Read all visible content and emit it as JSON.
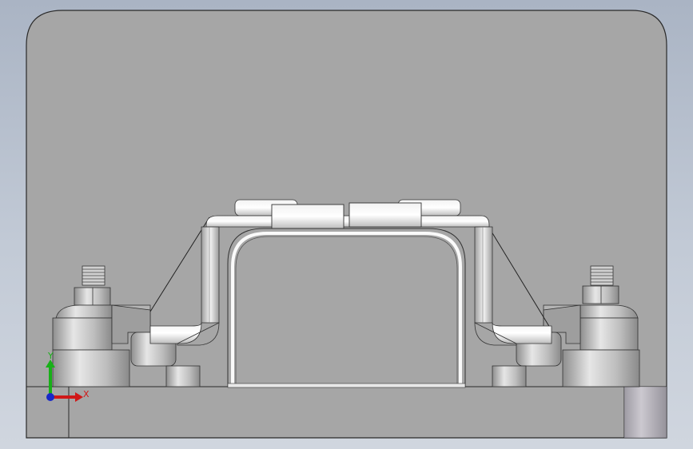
{
  "viewport": {
    "triad": {
      "x_label": "X",
      "y_label": "Y"
    }
  },
  "colors": {
    "background_top": "#aab4c4",
    "background_bottom": "#d0d6df",
    "part_face": "#a6a6a6",
    "part_edge": "#2a2a2a",
    "axis_x": "#d01818",
    "axis_y": "#18b018",
    "axis_z": "#1828c8"
  },
  "icons": [
    "coordinate-triad-icon"
  ]
}
